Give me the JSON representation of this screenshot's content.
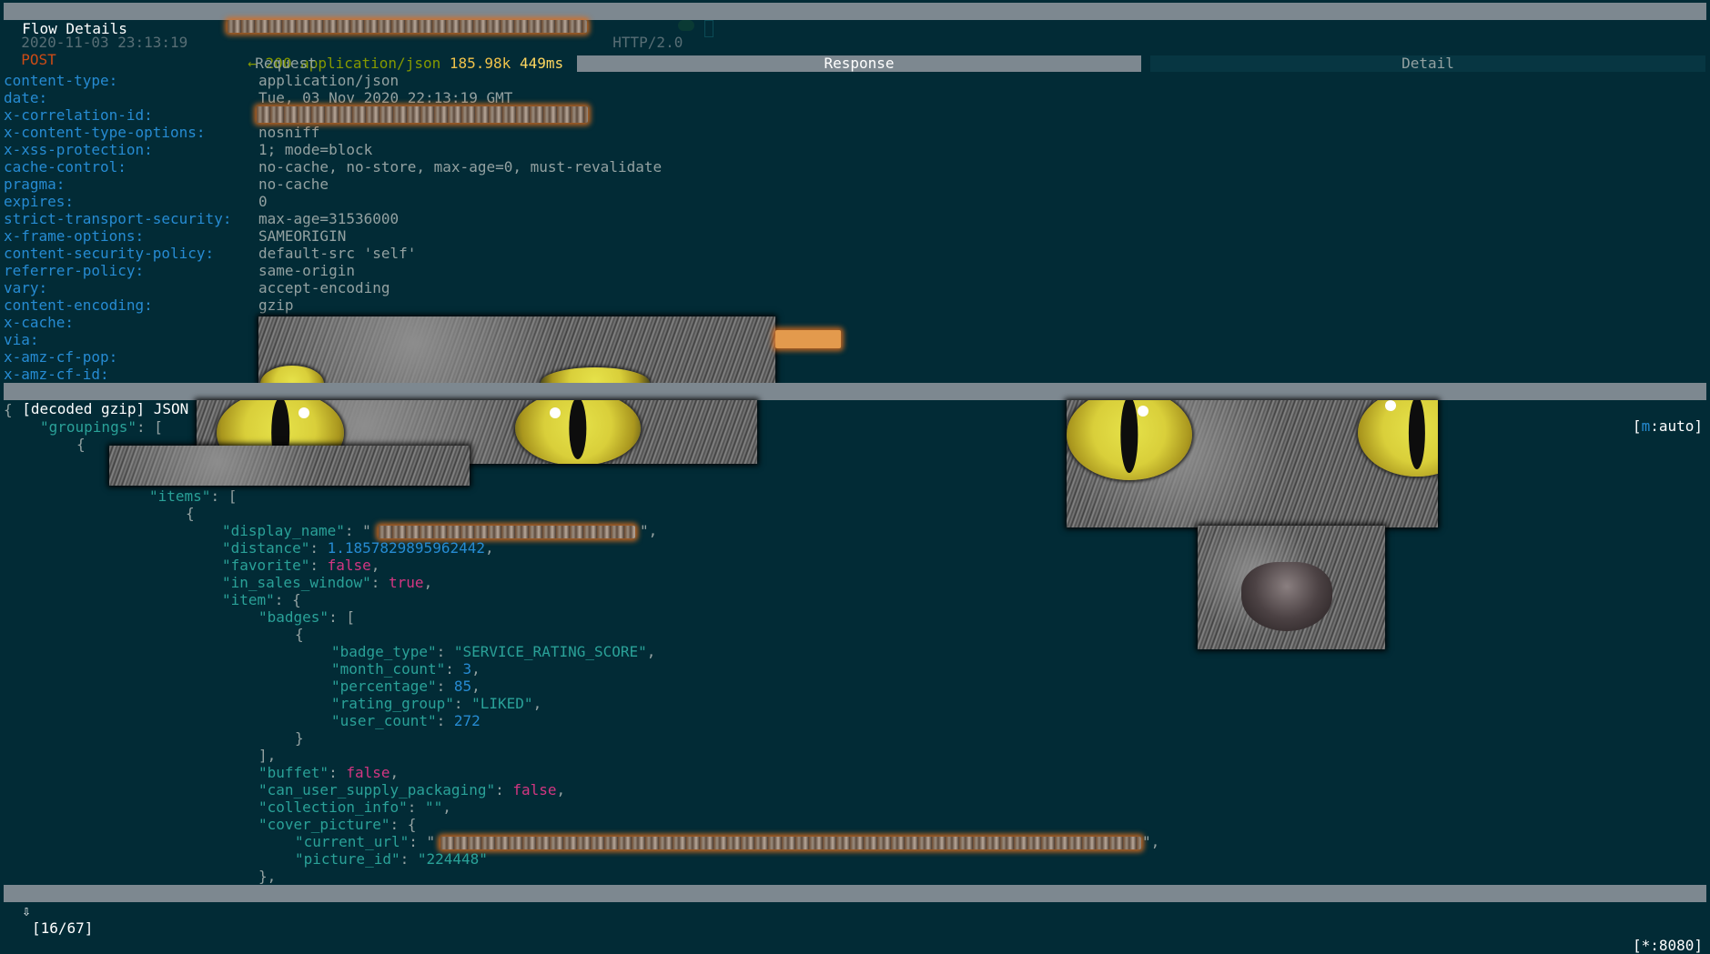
{
  "title_bar": "Flow Details",
  "flow": {
    "timestamp": "2020-11-03 23:13:19",
    "method": "POST",
    "protocol": "HTTP/2.0",
    "arrow": "←",
    "status": "200",
    "content_type": "application/json",
    "size": "185.98k",
    "duration": "449ms"
  },
  "tabs": [
    {
      "label": "Request",
      "active": false
    },
    {
      "label": "Response",
      "active": true
    },
    {
      "label": "Detail",
      "active": false
    }
  ],
  "headers": [
    {
      "key": "content-type:",
      "value": "application/json"
    },
    {
      "key": "date:",
      "value": "Tue, 03 Nov 2020 22:13:19 GMT"
    },
    {
      "key": "x-correlation-id:",
      "value": ""
    },
    {
      "key": "x-content-type-options:",
      "value": "nosniff"
    },
    {
      "key": "x-xss-protection:",
      "value": "1; mode=block"
    },
    {
      "key": "cache-control:",
      "value": "no-cache, no-store, max-age=0, must-revalidate"
    },
    {
      "key": "pragma:",
      "value": "no-cache"
    },
    {
      "key": "expires:",
      "value": "0"
    },
    {
      "key": "strict-transport-security:",
      "value": "max-age=31536000"
    },
    {
      "key": "x-frame-options:",
      "value": "SAMEORIGIN"
    },
    {
      "key": "content-security-policy:",
      "value": "default-src 'self'"
    },
    {
      "key": "referrer-policy:",
      "value": "same-origin"
    },
    {
      "key": "vary:",
      "value": "accept-encoding"
    },
    {
      "key": "content-encoding:",
      "value": "gzip"
    },
    {
      "key": "x-cache:",
      "value": ""
    },
    {
      "key": "via:",
      "value": ""
    },
    {
      "key": "x-amz-cf-pop:",
      "value": ""
    },
    {
      "key": "x-amz-cf-id:",
      "value": ""
    }
  ],
  "body_bar": {
    "left": "[decoded gzip] JSON",
    "right_prefix": "[",
    "right_marker": "m",
    "right_suffix": ":auto]"
  },
  "json": {
    "open_brace": "{",
    "groupings_key": "\"groupings\"",
    "colon_bracket": ": [",
    "inner_brace": "{",
    "items_key": "\"items\"",
    "item_brace": "{",
    "display_name_key": "\"display_name\"",
    "display_name_open": ": \"",
    "display_name_close": "\",",
    "distance_key": "\"distance\"",
    "distance_val": "1.1857829895962442",
    "favorite_key": "\"favorite\"",
    "favorite_val": "false",
    "in_sales_window_key": "\"in_sales_window\"",
    "in_sales_window_val": "true",
    "item_key": "\"item\"",
    "item_open": ": {",
    "badges_key": "\"badges\"",
    "badge_brace": "{",
    "badge_type_key": "\"badge_type\"",
    "badge_type_val": "\"SERVICE_RATING_SCORE\"",
    "month_count_key": "\"month_count\"",
    "month_count_val": "3",
    "percentage_key": "\"percentage\"",
    "percentage_val": "85",
    "rating_group_key": "\"rating_group\"",
    "rating_group_val": "\"LIKED\"",
    "user_count_key": "\"user_count\"",
    "user_count_val": "272",
    "badge_close": "}",
    "badges_close": "],",
    "buffet_key": "\"buffet\"",
    "buffet_val": "false",
    "can_user_supply_packaging_key": "\"can_user_supply_packaging\"",
    "can_user_supply_packaging_val": "false",
    "collection_info_key": "\"collection_info\"",
    "collection_info_val": "\"\"",
    "cover_picture_key": "\"cover_picture\"",
    "cover_picture_open": ": {",
    "current_url_key": "\"current_url\"",
    "current_url_open": ": \"",
    "current_url_close": "\",",
    "picture_id_key": "\"picture_id\"",
    "picture_id_val": "\"224448\"",
    "cover_close": "},"
  },
  "status_bar": {
    "left_icon": "⇩",
    "position": "[16/67]",
    "listen": "[*:8080]"
  }
}
